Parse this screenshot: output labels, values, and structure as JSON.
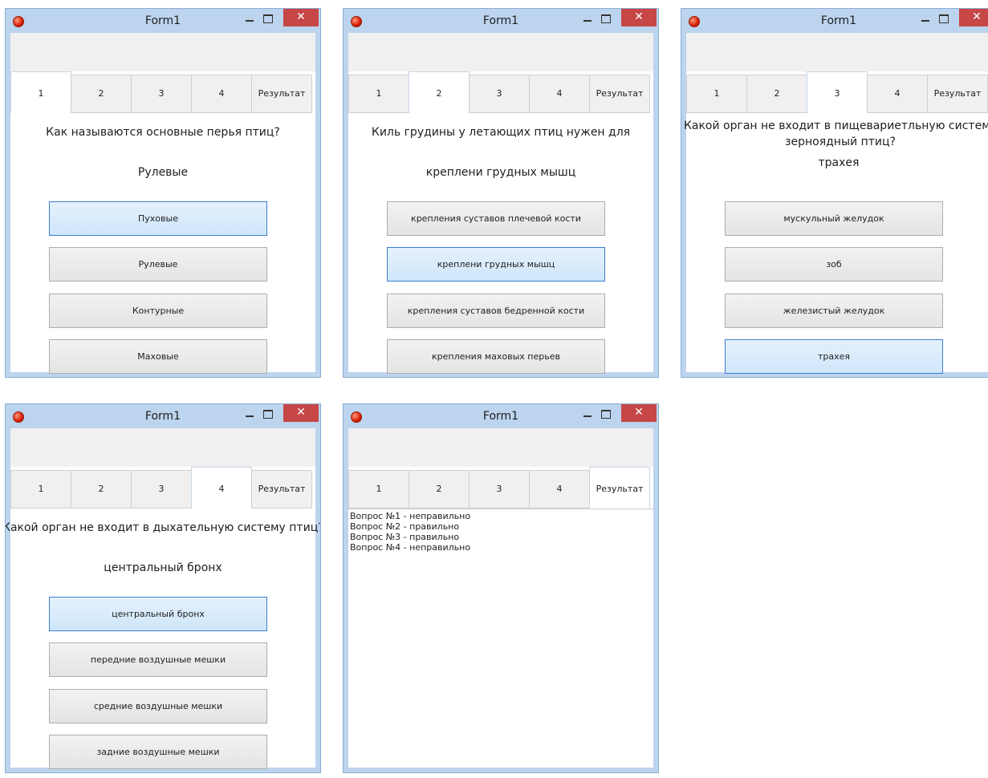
{
  "window_title": "Form1",
  "close_glyph": "✕",
  "tabs": [
    "1",
    "2",
    "3",
    "4",
    "Результат"
  ],
  "colors": {
    "title_bar": "#bcd4ee",
    "close_button": "#c74646",
    "selected_option": "#cfe6fb",
    "selected_border": "#3c7fd0"
  },
  "windows": [
    {
      "active_tab": 0,
      "question": "Как называются основные перья птиц?",
      "answer": "Рулевые",
      "options": [
        "Пуховые",
        "Рулевые",
        "Контурные",
        "Маховые"
      ],
      "selected_option": 0
    },
    {
      "active_tab": 1,
      "question": "Киль грудины у летающих птиц нужен для",
      "answer": "креплени грудных мышц",
      "options": [
        "крепления суставов плечевой кости",
        "креплени грудных мышц",
        "крепления суставов бедренной кости",
        "крепления маховых перьев"
      ],
      "selected_option": 1
    },
    {
      "active_tab": 2,
      "question": "Какой орган не входит в пищевариетльную систему зерноядный птиц?",
      "answer": "трахея",
      "options": [
        "мускульный желудок",
        "зоб",
        "железистый желудок",
        "трахея"
      ],
      "selected_option": 3
    },
    {
      "active_tab": 3,
      "question": "Какой орган не входит в дыхательную систему птиц?",
      "answer": "центральный бронх",
      "options": [
        "центральный бронх",
        "передние воздушные мешки",
        "средние воздушные мешки",
        "задние воздушные мешки"
      ],
      "selected_option": 0
    },
    {
      "active_tab": 4,
      "results": [
        "Вопрос №1 - неправильно",
        "Вопрос №2 - правильно",
        "Вопрос №3 - правильно",
        "Вопрос №4 - неправильно"
      ]
    }
  ]
}
